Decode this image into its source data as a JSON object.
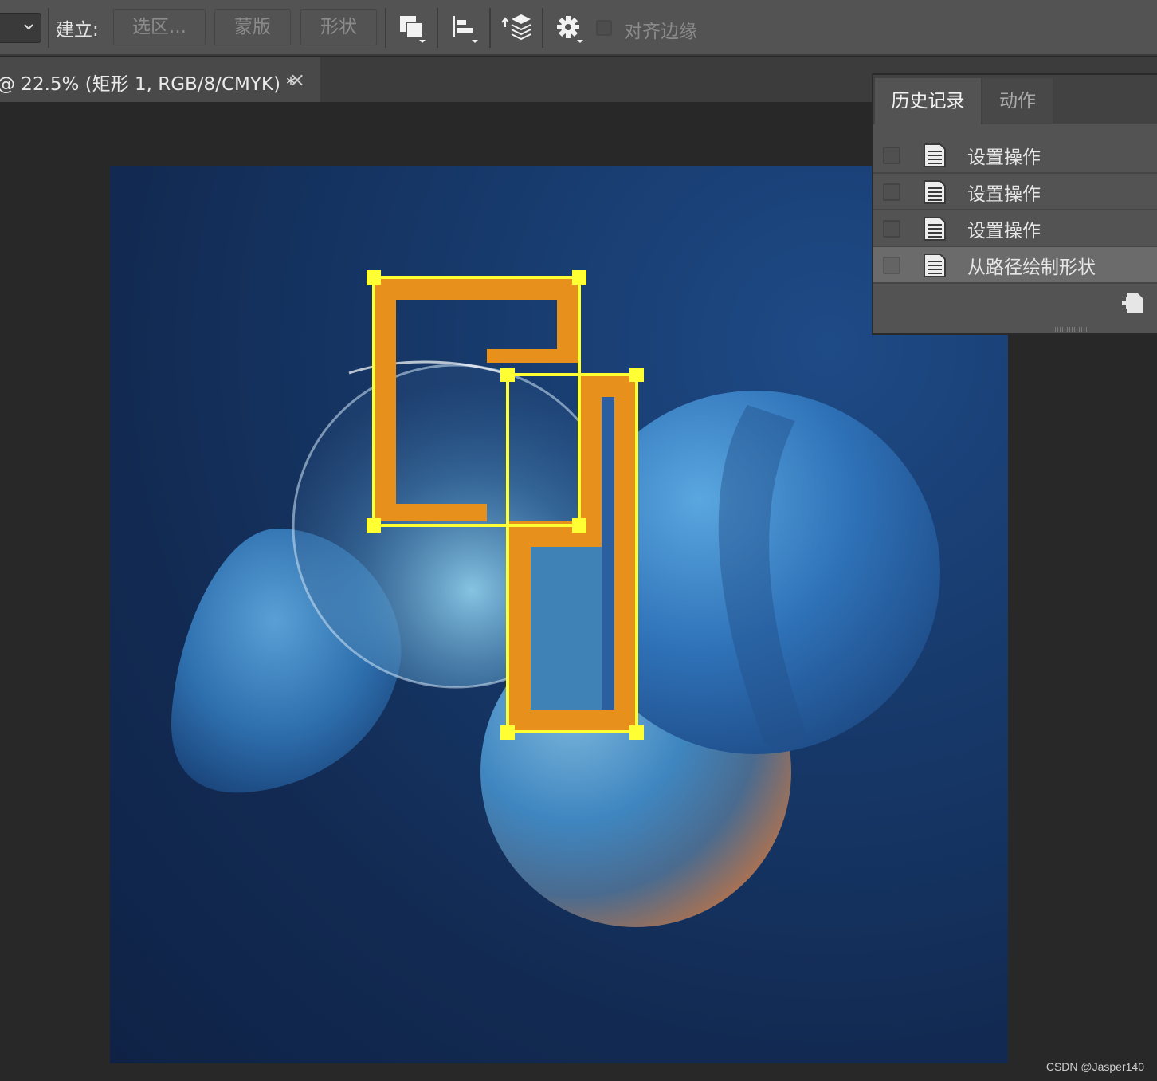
{
  "options_bar": {
    "make_label": "建立:",
    "buttons": {
      "selection": "选区...",
      "mask": "蒙版",
      "shape": "形状"
    },
    "icons": [
      "path-operations-icon",
      "path-alignment-icon",
      "path-arrangement-icon",
      "gear-icon"
    ],
    "snap_label": "对齐边缘",
    "snap_checked": false
  },
  "document_tab": {
    "title": "@ 22.5% (矩形 1, RGB/8/CMYK) *",
    "close_glyph": "×"
  },
  "history_panel": {
    "tabs": [
      "历史记录",
      "动作"
    ],
    "active_tab": "历史记录",
    "items": [
      {
        "label": "设置操作",
        "selected": false
      },
      {
        "label": "设置操作",
        "selected": false
      },
      {
        "label": "设置操作",
        "selected": false
      },
      {
        "label": "从路径绘制形状",
        "selected": true
      }
    ]
  },
  "shape_colors": {
    "fill": "#e8901c",
    "path": "#ffff33"
  },
  "watermark": "CSDN @Jasper140"
}
